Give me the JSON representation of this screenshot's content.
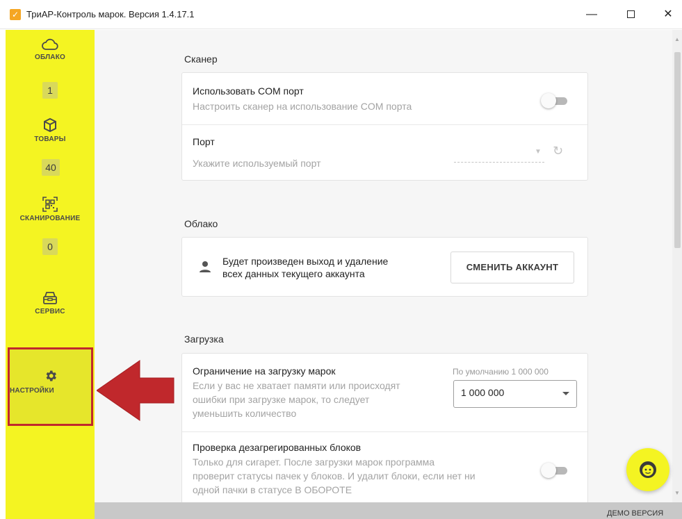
{
  "window": {
    "title": "ТриАР-Контроль марок. Версия 1.4.17.1",
    "minimize": "—",
    "close": "✕"
  },
  "sidebar": {
    "items": [
      {
        "label": "ОБЛАКО",
        "icon": "cloud-icon",
        "badge": "1"
      },
      {
        "label": "ТОВАРЫ",
        "icon": "box-icon",
        "badge": "40"
      },
      {
        "label": "СКАНИРОВАНИЕ",
        "icon": "qr-scan-icon",
        "badge": "0"
      },
      {
        "label": "СЕРВИС",
        "icon": "service-icon"
      },
      {
        "label": "НАСТРОЙКИ",
        "icon": "gear-icon",
        "selected": true
      }
    ]
  },
  "scanner": {
    "title": "Сканер",
    "com_port": {
      "label": "Использовать COM порт",
      "description": "Настроить сканер на использование COM порта",
      "enabled": false
    },
    "port": {
      "label": "Порт",
      "placeholder": "Укажите используемый порт"
    }
  },
  "cloud": {
    "title": "Облако",
    "message_line1": "Будет произведен выход и удаление",
    "message_line2": "всех данных текущего аккаунта",
    "switch_button": "СМЕНИТЬ АККАУНТ"
  },
  "loading": {
    "title": "Загрузка",
    "limit": {
      "label": "Ограничение на загрузку марок",
      "description_lines": [
        "Если у вас не хватает памяти или происходят",
        "ошибки при загрузке марок, то следует",
        "уменьшить количество"
      ],
      "default_hint": "По умолчанию 1 000 000",
      "value": "1 000 000"
    },
    "disaggregated": {
      "label": "Проверка дезагрегированных блоков",
      "description_lines": [
        "Только для сигарет. После загрузки марок программа",
        "проверит статусы пачек у блоков. И удалит блоки, если нет ни",
        "одной пачки в статусе В ОБОРОТЕ"
      ],
      "enabled": false
    }
  },
  "footer": {
    "demo": "ДЕМО ВЕРСИЯ"
  },
  "colors": {
    "sidebar": "#f4f422",
    "highlight_border": "#c0282c",
    "arrow": "#c0282c",
    "app_icon": "#f5a623"
  }
}
